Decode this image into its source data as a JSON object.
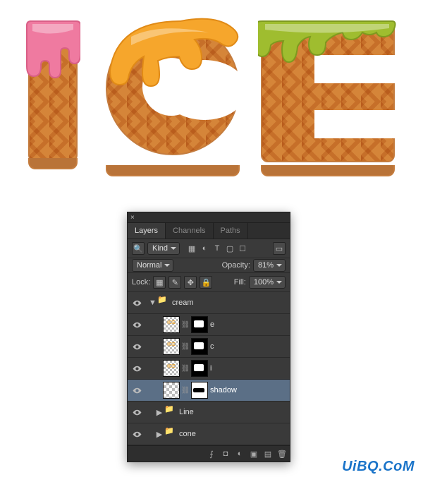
{
  "artwork_text": "ICE",
  "drip_colors": {
    "i": "#ef7aa0",
    "c": "#f6a62c",
    "e": "#9fbd2f"
  },
  "panel": {
    "tabs": [
      "Layers",
      "Channels",
      "Paths"
    ],
    "filter_kind": "Kind",
    "blend_mode": "Normal",
    "opacity_label": "Opacity:",
    "opacity_value": "81%",
    "lock_label": "Lock:",
    "fill_label": "Fill:",
    "fill_value": "100%",
    "layers": [
      {
        "name": "cream",
        "type": "group",
        "expanded": true
      },
      {
        "name": "e",
        "type": "masked",
        "selected": false
      },
      {
        "name": "c",
        "type": "masked",
        "selected": false
      },
      {
        "name": "i",
        "type": "masked",
        "selected": false
      },
      {
        "name": "shadow",
        "type": "masked",
        "selected": true
      },
      {
        "name": "Line",
        "type": "group",
        "expanded": false
      },
      {
        "name": "cone",
        "type": "group",
        "expanded": false
      }
    ]
  },
  "watermark": "UiBQ.CoM"
}
